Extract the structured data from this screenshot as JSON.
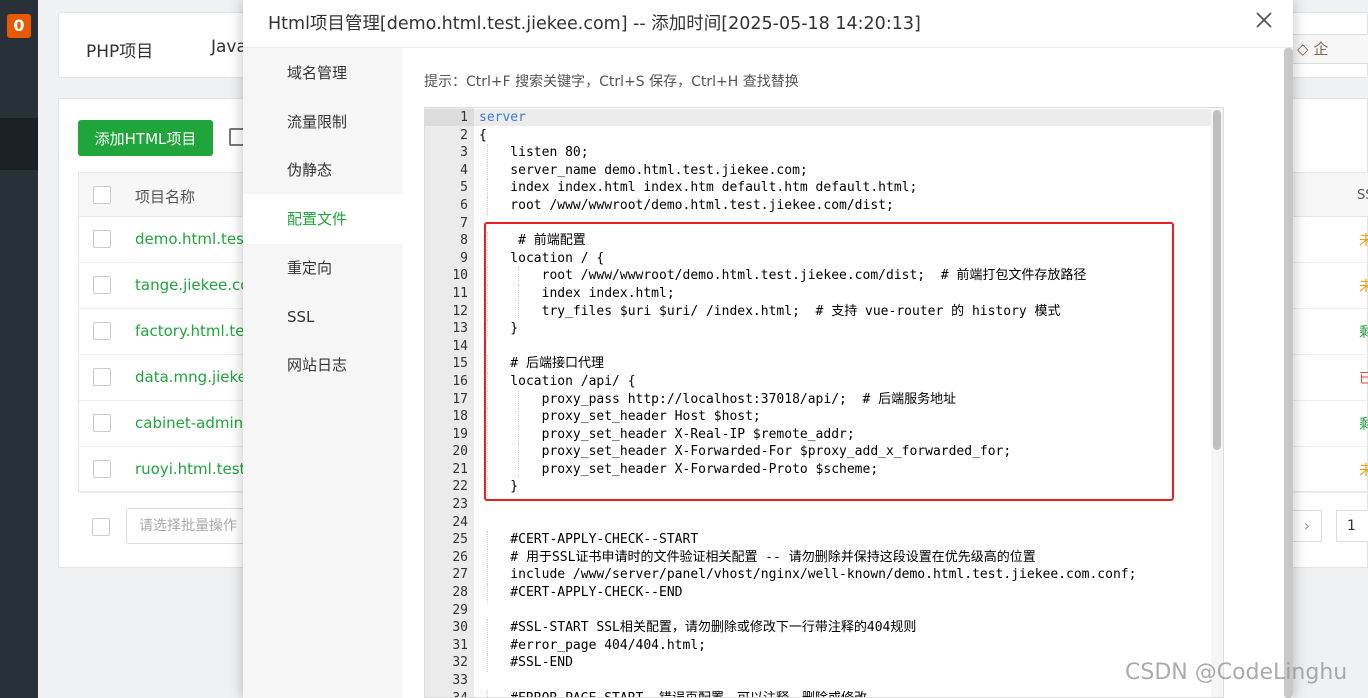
{
  "left_nav": {
    "badge": "0"
  },
  "background": {
    "tabs": [
      "PHP项目",
      "Java"
    ],
    "vip_label": "企",
    "add_button_label": "添加HTML项目",
    "table": {
      "header_name": "项目名称",
      "header_ssl": "SS",
      "rows": [
        {
          "name": "demo.html.test",
          "ssl": "未",
          "ssl_color": "#f0a000"
        },
        {
          "name": "tange.jiekee.co",
          "ssl": "未",
          "ssl_color": "#f0a000"
        },
        {
          "name": "factory.html.tes",
          "ssl": "剩",
          "ssl_color": "#20a53a"
        },
        {
          "name": "data.mng.jieke",
          "ssl": "已",
          "ssl_color": "#e63e3e"
        },
        {
          "name": "cabinet-admin.t",
          "ssl": "剩",
          "ssl_color": "#20a53a"
        },
        {
          "name": "ruoyi.html.test.j",
          "ssl": "未",
          "ssl_color": "#f0a000"
        }
      ]
    },
    "batch_placeholder": "请选择批量操作",
    "pager_next": "›",
    "pager_page": "1"
  },
  "modal": {
    "title": "Html项目管理[demo.html.test.jiekee.com] -- 添加时间[2025-05-18 14:20:13]",
    "sidebar": [
      "域名管理",
      "流量限制",
      "伪静态",
      "配置文件",
      "重定向",
      "SSL",
      "网站日志"
    ],
    "active_item": "配置文件",
    "hint": "提示：Ctrl+F 搜索关键字，Ctrl+S 保存，Ctrl+H 查找替换",
    "code_lines": [
      "server",
      "{",
      "    listen 80;",
      "    server_name demo.html.test.jiekee.com;",
      "    index index.html index.htm default.htm default.html;",
      "    root /www/wwwroot/demo.html.test.jiekee.com/dist;",
      "",
      "     # 前端配置",
      "    location / {",
      "        root /www/wwwroot/demo.html.test.jiekee.com/dist;  # 前端打包文件存放路径",
      "        index index.html;",
      "        try_files $uri $uri/ /index.html;  # 支持 vue-router 的 history 模式",
      "    }",
      "",
      "    # 后端接口代理",
      "    location /api/ {",
      "        proxy_pass http://localhost:37018/api/;  # 后端服务地址",
      "        proxy_set_header Host $host;",
      "        proxy_set_header X-Real-IP $remote_addr;",
      "        proxy_set_header X-Forwarded-For $proxy_add_x_forwarded_for;",
      "        proxy_set_header X-Forwarded-Proto $scheme;",
      "    }",
      "",
      "",
      "    #CERT-APPLY-CHECK--START",
      "    # 用于SSL证书申请时的文件验证相关配置 -- 请勿删除并保持这段设置在优先级高的位置",
      "    include /www/server/panel/vhost/nginx/well-known/demo.html.test.jiekee.com.conf;",
      "    #CERT-APPLY-CHECK--END",
      "",
      "    #SSL-START SSL相关配置，请勿删除或修改下一行带注释的404规则",
      "    #error_page 404/404.html;",
      "    #SSL-END",
      "",
      "    #ERROR-PAGE-START  错误页配置，可以注释、删除或修改"
    ]
  },
  "watermark": "CSDN @CodeLinghu"
}
